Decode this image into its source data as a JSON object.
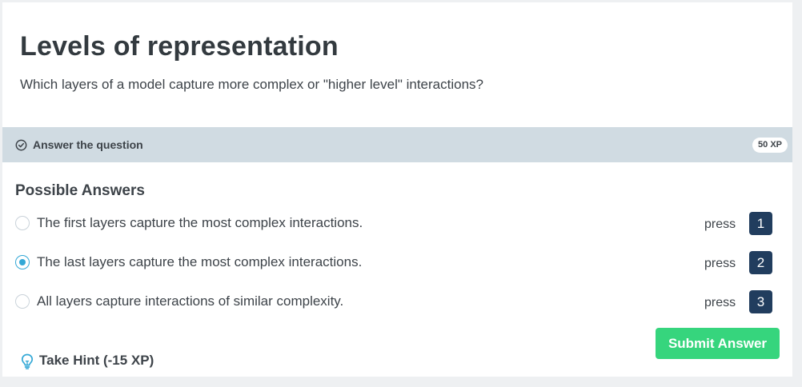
{
  "exercise": {
    "title": "Levels of representation",
    "question": "Which layers of a model capture more complex or \"higher level\" interactions?"
  },
  "banner": {
    "label": "Answer the question",
    "xp": "50 XP",
    "icon": "check-circle-icon"
  },
  "answers": {
    "heading": "Possible Answers",
    "press_label": "press",
    "selected_index": 1,
    "options": [
      {
        "text": "The first layers capture the most complex interactions.",
        "key": "1",
        "checked": false
      },
      {
        "text": "The last layers capture the most complex interactions.",
        "key": "2",
        "checked": true
      },
      {
        "text": "All layers capture interactions of similar complexity.",
        "key": "3",
        "checked": false
      }
    ]
  },
  "actions": {
    "submit_label": "Submit Answer",
    "hint_label": "Take Hint (-15 XP)",
    "hint_icon": "lightbulb-icon"
  },
  "colors": {
    "banner_bg": "#d0dbe2",
    "radio_accent": "#33a8d6",
    "key_bg": "#213d5e",
    "submit_bg": "#36d57d",
    "hint_icon": "#33a8d6"
  }
}
